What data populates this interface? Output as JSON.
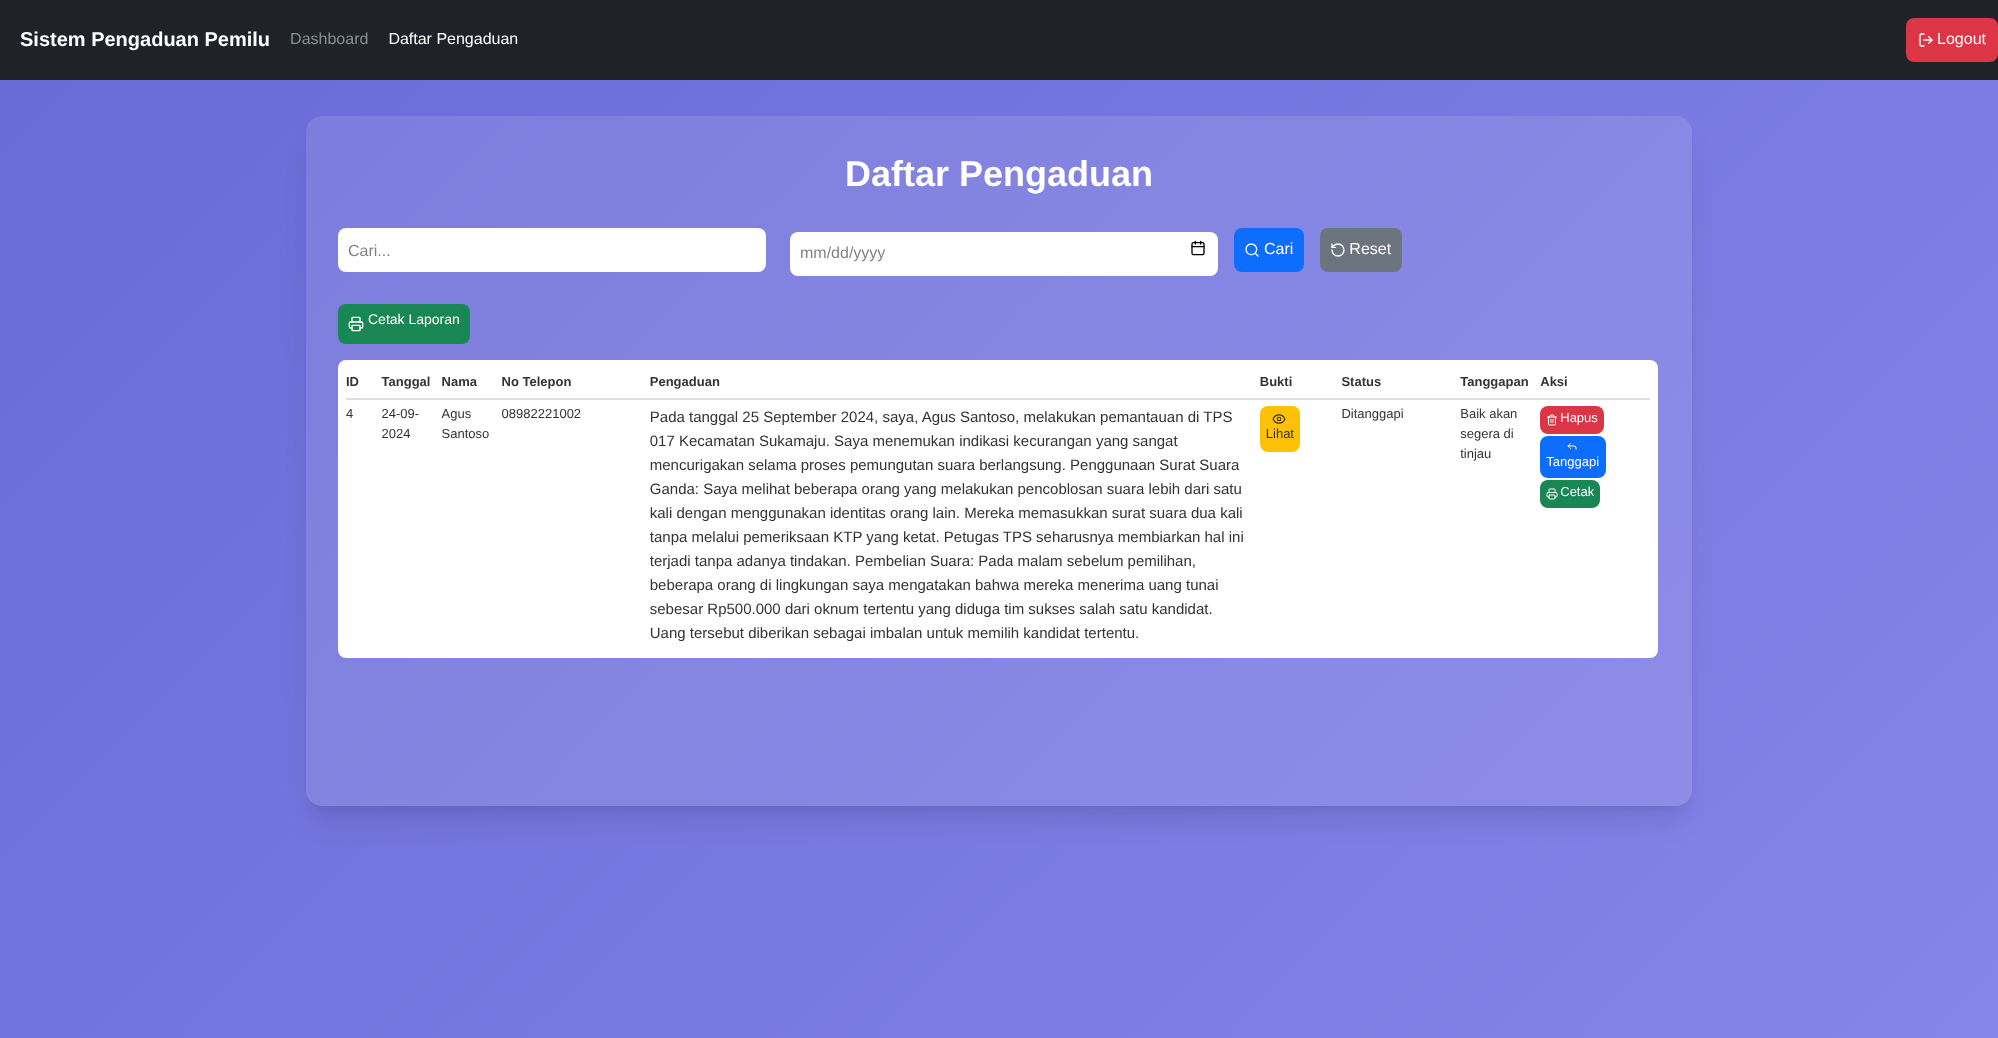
{
  "navbar": {
    "brand": "Sistem Pengaduan Pemilu",
    "links": [
      {
        "label": "Dashboard",
        "selected": false
      },
      {
        "label": "Daftar Pengaduan",
        "selected": true
      }
    ],
    "logout": "Logout"
  },
  "title": "Daftar Pengaduan",
  "filters": {
    "search": {
      "placeholder": "Cari..."
    },
    "date": {
      "placeholder": "mm/dd/yyyy"
    },
    "search_button": "Cari",
    "reset_button": "Reset"
  },
  "print_button": "Cetak Laporan",
  "table": {
    "columns": [
      "ID",
      "Tanggal",
      "Nama",
      "No Telepon",
      "Pengaduan",
      "Bukti",
      "Status",
      "Tanggapan",
      "Aksi"
    ],
    "rows": [
      {
        "id": "4",
        "date": "24-09-2024",
        "name": "Agus Santoso",
        "phone": "08982221002",
        "complaint": "Pada tanggal 25 September 2024, saya, Agus Santoso, melakukan pemantauan di TPS 017 Kecamatan Sukamaju. Saya menemukan indikasi kecurangan yang sangat mencurigakan selama proses pemungutan suara berlangsung. Penggunaan Surat Suara Ganda: Saya melihat beberapa orang yang melakukan pencoblosan suara lebih dari satu kali dengan menggunakan identitas orang lain. Mereka memasukkan surat suara dua kali tanpa melalui pemeriksaan KTP yang ketat. Petugas TPS seharusnya membiarkan hal ini terjadi tanpa adanya tindakan. Pembelian Suara: Pada malam sebelum pemilihan, beberapa orang di lingkungan saya mengatakan bahwa mereka menerima uang tunai sebesar Rp500.000 dari oknum tertentu yang diduga tim sukses salah satu kandidat. Uang tersebut diberikan sebagai imbalan untuk memilih kandidat tertentu.",
        "evidence": "Lihat",
        "status": "Ditanggapi",
        "response": "Baik akan segera di tinjau",
        "actions": [
          {
            "kind": "delete",
            "label": "Hapus"
          },
          {
            "kind": "reply",
            "label": "Tanggapi"
          },
          {
            "kind": "print",
            "label": "Cetak"
          }
        ]
      }
    ]
  }
}
